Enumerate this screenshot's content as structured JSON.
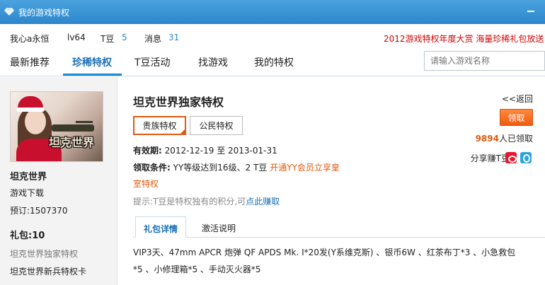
{
  "window": {
    "title": "我的游戏特权"
  },
  "user": {
    "name": "我心a永恒",
    "level": "lv64",
    "tdou_label": "T豆",
    "tdou_value": "5",
    "msg_label": "消息",
    "msg_value": "31",
    "promo": "2012游戏特权年度大赏  海量珍稀礼包放送"
  },
  "nav": {
    "tabs": [
      "最新推荐",
      "珍稀特权",
      "T豆活动",
      "找游戏",
      "我的特权"
    ],
    "search_placeholder": "请输入游戏名称"
  },
  "sidebar": {
    "poster_logo": "坦克世界",
    "game_name": "坦克世界",
    "download": "游戏下载",
    "reservations": "预订:1507370",
    "gift_count": "礼包:10",
    "items": [
      "坦克世界独家特权",
      "坦克世界新兵特权卡"
    ]
  },
  "detail": {
    "title": "坦克世界独家特权",
    "back": "<<返回",
    "claim": "领取",
    "claimed_count": "9894",
    "claimed_suffix": "人已领取",
    "share": "分享赚T豆:",
    "seg_on": "贵族特权",
    "seg_off": "公民特权",
    "valid_label": "有效期:",
    "valid_value": "2012-12-19 至  2013-01-31",
    "cond_label": "领取条件:",
    "cond_value": "YY等级达到16级、2 T豆",
    "cond_link_a": "开通YY会员立享皇",
    "cond_link_b": "室特权",
    "hint_text": "提示:T豆是特权独有的积分,可",
    "hint_link": "点此赚取",
    "subtab_on": "礼包详情",
    "subtab_off": "激活说明",
    "gift_line1": "VIP3天、47mm APCR 炮弹  QF APDS Mk. I*20发(Y系维克斯)  、银币6W 、红茶布丁*3 、小急救包",
    "gift_line2": "*5 、小修理箱*5 、手动灭火器*5"
  },
  "colors": {
    "accent": "#1a6fb7",
    "orange": "#e05a10",
    "promo_red": "#d40000"
  }
}
